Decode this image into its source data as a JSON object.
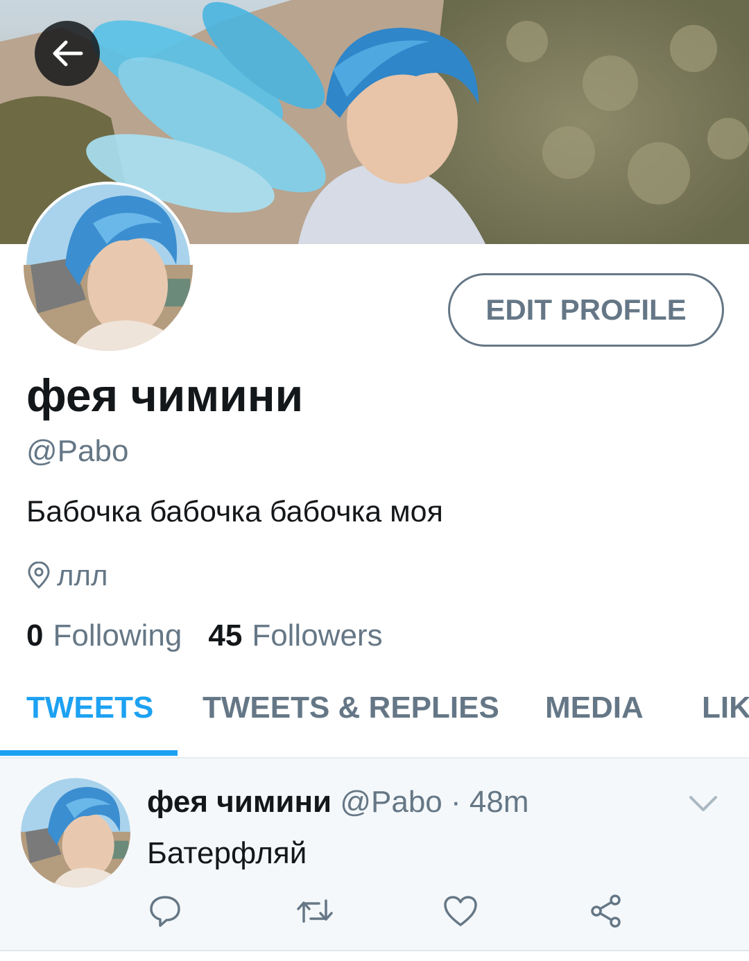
{
  "header": {
    "back_icon": "arrow-left-icon"
  },
  "profile": {
    "display_name": "фея чимини",
    "handle": "@Pabo",
    "bio": "Бабочка бабочка бабочка моя",
    "location": "ллл",
    "location_icon": "map-pin-icon",
    "edit_profile_label": "EDIT PROFILE",
    "following_count": "0",
    "following_label": "Following",
    "followers_count": "45",
    "followers_label": "Followers"
  },
  "tabs": [
    {
      "label": "TWEETS",
      "active": true
    },
    {
      "label": "TWEETS & REPLIES",
      "active": false
    },
    {
      "label": "MEDIA",
      "active": false
    },
    {
      "label": "LIK",
      "active": false
    }
  ],
  "tweets": [
    {
      "author": "фея чимини",
      "meta": "@Pabo · 48m",
      "text": "Батерфляй",
      "menu_icon": "chevron-down-icon",
      "actions": [
        "reply-icon",
        "retweet-icon",
        "like-icon",
        "share-icon"
      ]
    }
  ],
  "colors": {
    "accent": "#1da1f2",
    "secondary_text": "#657786",
    "primary_text": "#14171a"
  }
}
